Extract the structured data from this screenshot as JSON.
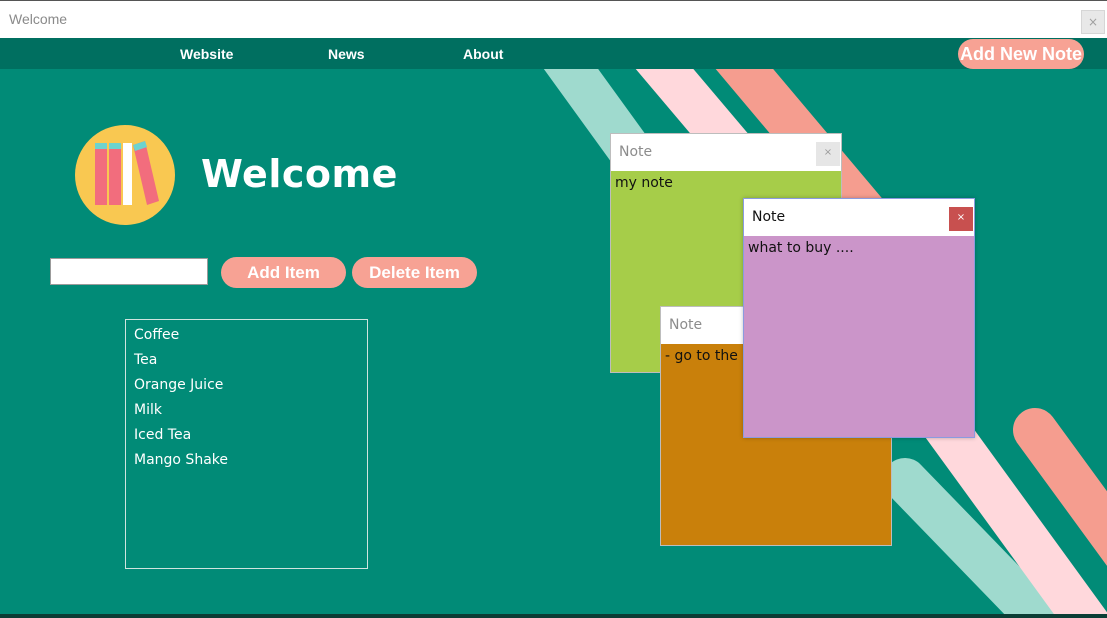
{
  "window": {
    "title": "Welcome",
    "close_glyph": "×"
  },
  "nav": {
    "links": [
      "Website",
      "News",
      "About"
    ],
    "add_note_label": "Add New Note"
  },
  "main": {
    "heading": "Welcome",
    "input_value": "",
    "add_item_label": "Add Item",
    "delete_item_label": "Delete Item",
    "items": [
      "Coffee",
      "Tea",
      "Orange Juice",
      "Milk",
      "Iced Tea",
      "Mango Shake"
    ]
  },
  "notes": [
    {
      "title": "Note",
      "body": "my note",
      "color": "#a6cd49",
      "close_glyph": "×"
    },
    {
      "title": "Note",
      "body": "- go to the gym",
      "color": "#c9800b",
      "close_glyph": "×"
    },
    {
      "title": "Note",
      "body": "what to buy ....",
      "color": "#cb95c9",
      "close_glyph": "×"
    }
  ],
  "colors": {
    "background": "#018b77",
    "navbar": "#006f60",
    "accent": "#f7a294",
    "logo_circle": "#f9c851",
    "active_close": "#c8504f"
  },
  "icons": {
    "logo": "books-icon",
    "close": "close-icon"
  }
}
